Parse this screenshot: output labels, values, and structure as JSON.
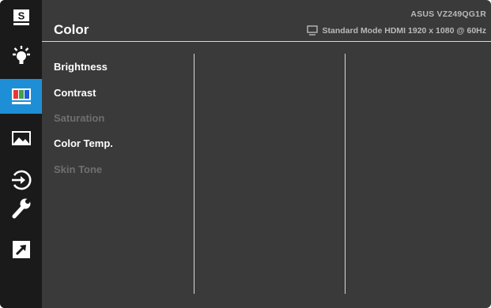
{
  "header": {
    "title": "Color",
    "model": "ASUS  VZ249QG1R",
    "status": "Standard Mode HDMI 1920 x 1080 @ 60Hz",
    "status_icon": "monitor-icon"
  },
  "sidebar": {
    "items": [
      {
        "icon": "splendid-s-icon",
        "active": false
      },
      {
        "icon": "blue-light-filter-icon",
        "active": false
      },
      {
        "icon": "color-bars-icon",
        "active": true
      },
      {
        "icon": "image-icon",
        "active": false
      },
      {
        "icon": "input-select-icon",
        "active": false
      },
      {
        "icon": "wrench-icon",
        "active": false
      },
      {
        "icon": "shortcut-arrow-icon",
        "active": false
      }
    ]
  },
  "menu": {
    "items": [
      {
        "label": "Brightness",
        "enabled": true
      },
      {
        "label": "Contrast",
        "enabled": true
      },
      {
        "label": "Saturation",
        "enabled": false
      },
      {
        "label": "Color Temp.",
        "enabled": true
      },
      {
        "label": "Skin Tone",
        "enabled": false
      }
    ]
  },
  "colors": {
    "active_tab": "#1e8fd6",
    "panel_background": "#3a3a3a",
    "sidebar_background": "#1a1a1a",
    "disabled_text": "#6f6f6f"
  }
}
